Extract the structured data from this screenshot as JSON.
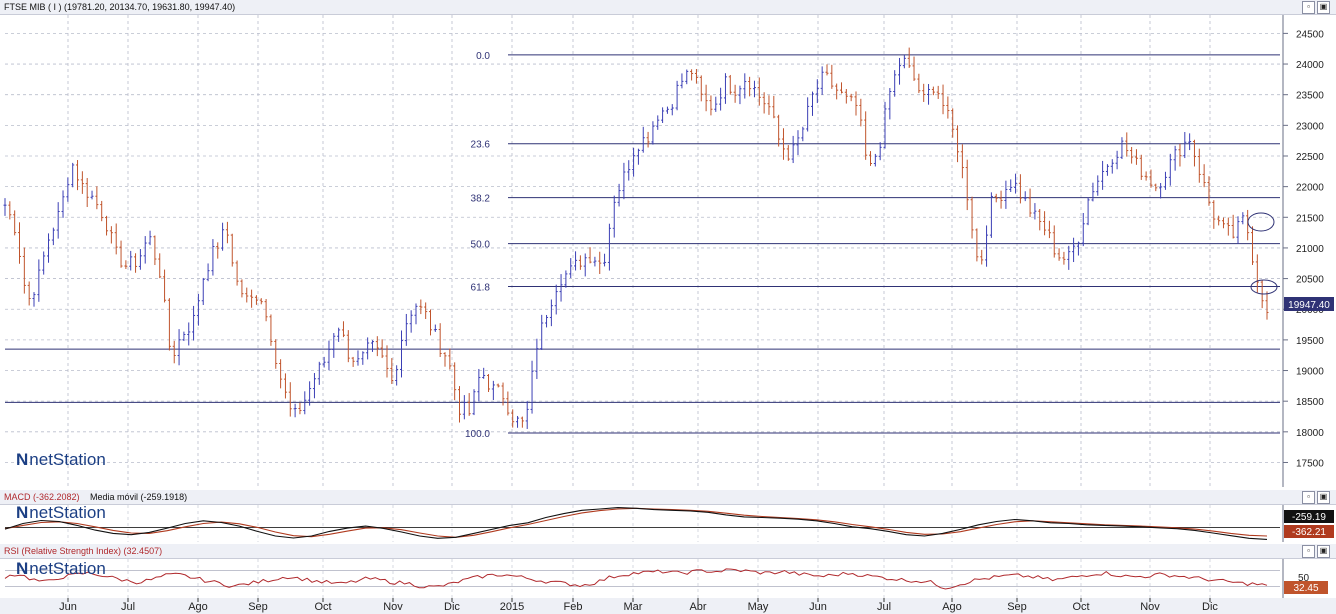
{
  "main": {
    "header": "FTSE MIB ( I ) (19781.20, 20134.70, 19631.80, 19947.40)",
    "last_value_label": "19947.40",
    "y_ticks": [
      "24500",
      "24000",
      "23500",
      "23000",
      "22500",
      "22000",
      "21500",
      "21000",
      "20500",
      "20000",
      "19500",
      "19000",
      "18500",
      "18000",
      "17500"
    ],
    "fib_levels": [
      {
        "label": "0.0",
        "value": 24150
      },
      {
        "label": "23.6",
        "value": 22700
      },
      {
        "label": "38.2",
        "value": 21820
      },
      {
        "label": "50.0",
        "value": 21070
      },
      {
        "label": "61.8",
        "value": 20370
      },
      {
        "label": "100.0",
        "value": 17980
      }
    ],
    "support_lines": [
      19350,
      18480
    ]
  },
  "macd": {
    "title_macd": "MACD (-362.2082)",
    "title_ma": "Media móvil (-259.1918)",
    "value_ma": "-259.19",
    "value_macd": "-362.21"
  },
  "rsi": {
    "title": "RSI (Relative Strength Index) (32.4507)",
    "tick": "50",
    "value": "32.45"
  },
  "x_axis": {
    "labels": [
      "Jun",
      "Jul",
      "Ago",
      "Sep",
      "Oct",
      "Nov",
      "Dic",
      "2015",
      "Feb",
      "Mar",
      "Abr",
      "May",
      "Jun",
      "Jul",
      "Ago",
      "Sep",
      "Oct",
      "Nov",
      "Dic"
    ]
  },
  "branding": {
    "logo_text": "netStation"
  },
  "colors": {
    "up": "#3b3fb5",
    "down": "#c0542c",
    "fib": "#2f3275",
    "macd": "#111111",
    "signal": "#b03a1e",
    "rsi": "#b0292d",
    "value_box": "#2f3275"
  },
  "chart_data": [
    {
      "type": "candlestick",
      "title": "FTSE MIB ( I ) (19781.20, 20134.70, 19631.80, 19947.40)",
      "x_labels": [
        "Jun",
        "Jul",
        "Ago",
        "Sep",
        "Oct",
        "Nov",
        "Dic",
        "2015",
        "Feb",
        "Mar",
        "Abr",
        "May",
        "Jun",
        "Jul",
        "Ago",
        "Sep",
        "Oct",
        "Nov",
        "Dic"
      ],
      "ylim": [
        17100,
        24800
      ],
      "series": [
        {
          "values": [
            21700,
            21300,
            20100,
            20500,
            21200,
            21600,
            22400,
            22000,
            21800,
            21500,
            20900,
            20700,
            20800,
            21200,
            20600,
            19200,
            19600,
            19800,
            20600,
            21000,
            21300,
            20400,
            20100,
            20300,
            19600,
            18800,
            18200,
            18500,
            18900,
            19200,
            19800,
            19300,
            19100,
            19400,
            19200,
            18800,
            19700,
            20100,
            19900,
            19500,
            19200,
            18400,
            18300,
            19000,
            18700,
            18600,
            18200,
            18100,
            19400,
            20000,
            20500,
            20600,
            20800,
            20900,
            20700,
            21800,
            22200,
            22700,
            22800,
            23200,
            23300,
            23700,
            23900,
            23400,
            23300,
            23700,
            23600,
            23800,
            23500,
            23300,
            22700,
            22500,
            22900,
            23500,
            23800,
            23600,
            23400,
            23300,
            22200,
            22700,
            23600,
            24100,
            23800,
            23400,
            23700,
            23200,
            22700,
            21800,
            20600,
            21700,
            21900,
            22100,
            21800,
            21500,
            21300,
            20900,
            20800,
            21200,
            21900,
            22200,
            22500,
            22700,
            22400,
            22200,
            22000,
            22300,
            22600,
            22800,
            22200,
            21600,
            21300,
            21200,
            21500,
            20600,
            19950
          ]
        }
      ],
      "last": 19947.4
    },
    {
      "type": "line",
      "title": "MACD (-362.2082)",
      "series": [
        {
          "name": "MACD",
          "values": [
            -50,
            120,
            210,
            180,
            60,
            -80,
            -180,
            -220,
            -150,
            -20,
            120,
            200,
            150,
            40,
            -120,
            -260,
            -320,
            -260,
            -120,
            -20,
            40,
            -30,
            -140,
            -260,
            -330,
            -300,
            -180,
            -60,
            60,
            140,
            300,
            420,
            520,
            560,
            600,
            580,
            540,
            520,
            500,
            460,
            380,
            320,
            300,
            280,
            250,
            200,
            120,
            20,
            -40,
            -120,
            -220,
            -260,
            -180,
            -60,
            80,
            180,
            240,
            200,
            140,
            120,
            80,
            60,
            40,
            20,
            -10,
            -40,
            -90,
            -170,
            -250,
            -330,
            -362
          ]
        },
        {
          "name": "Media móvil",
          "values": [
            -40,
            60,
            150,
            170,
            120,
            20,
            -90,
            -170,
            -180,
            -100,
            20,
            120,
            160,
            110,
            0,
            -140,
            -250,
            -280,
            -210,
            -110,
            -20,
            -10,
            -70,
            -170,
            -260,
            -300,
            -240,
            -130,
            -10,
            90,
            210,
            330,
            440,
            510,
            560,
            580,
            560,
            540,
            520,
            490,
            430,
            370,
            330,
            300,
            270,
            230,
            170,
            90,
            20,
            -60,
            -150,
            -210,
            -200,
            -130,
            -20,
            90,
            170,
            200,
            170,
            140,
            110,
            80,
            60,
            40,
            15,
            -10,
            -50,
            -110,
            -180,
            -240,
            -259
          ]
        }
      ],
      "last_labels": [
        "-259.19",
        "-362.21"
      ]
    },
    {
      "type": "line",
      "title": "RSI (Relative Strength Index) (32.4507)",
      "series": [
        {
          "name": "RSI",
          "values": [
            55,
            62,
            48,
            40,
            52,
            58,
            64,
            60,
            52,
            45,
            40,
            48,
            58,
            60,
            52,
            44,
            38,
            30,
            36,
            42,
            48,
            55,
            50,
            44,
            40,
            36,
            42,
            50,
            46,
            40,
            38,
            30,
            28,
            34,
            44,
            52,
            58,
            60,
            56,
            50,
            44,
            40,
            36,
            32,
            40,
            52,
            60,
            64,
            66,
            68,
            64,
            66,
            70,
            68,
            72,
            70,
            66,
            64,
            68,
            62,
            58,
            56,
            60,
            64,
            58,
            54,
            50,
            46,
            44,
            40,
            26,
            34,
            44,
            50,
            54,
            58,
            56,
            52,
            46,
            50,
            56,
            62,
            64,
            58,
            54,
            56,
            60,
            58,
            54,
            50,
            46,
            42,
            38,
            36,
            32
          ]
        }
      ],
      "ytick": 50,
      "last": 32.45
    }
  ]
}
